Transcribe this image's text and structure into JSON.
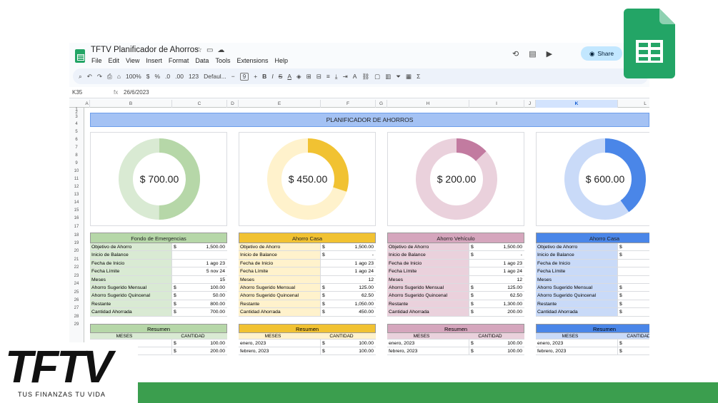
{
  "app": {
    "title": "TFTV Planificador de Ahorros",
    "menu": [
      "File",
      "Edit",
      "View",
      "Insert",
      "Format",
      "Data",
      "Tools",
      "Extensions",
      "Help"
    ],
    "share_label": "Share",
    "toolbar": {
      "zoom": "100%",
      "currency": "$",
      "percent": "%",
      "dec_less": ".0",
      "dec_more": ".00",
      "num_format": "123",
      "font": "Defaul...",
      "font_size": "9"
    },
    "formula_bar": {
      "cell_ref": "K35",
      "fx": "fx",
      "value": "26/6/2023"
    }
  },
  "sheet": {
    "columns": [
      "A",
      "B",
      "C",
      "D",
      "E",
      "F",
      "G",
      "H",
      "I",
      "J",
      "K",
      "L"
    ],
    "selected_column": "K",
    "rows": [
      "1",
      "2",
      "3",
      "4",
      "5",
      "6",
      "7",
      "8",
      "9",
      "10",
      "11",
      "12",
      "13",
      "14",
      "15",
      "16",
      "17",
      "18",
      "19",
      "20",
      "21",
      "22",
      "23",
      "24",
      "25",
      "26",
      "27",
      "28",
      "29"
    ],
    "banner": "PLANIFICADOR DE AHORROS",
    "cards": [
      {
        "value": "$ 700.00",
        "percent": 50,
        "fill": "#b6d7a8",
        "track": "#d9ead3",
        "header": "Fondo de Emergencias",
        "head_bg": "#b6d7a8",
        "label_bg": "#d9ead3",
        "rows": [
          [
            "Objetivo de Ahorro",
            "$",
            "1,500.00"
          ],
          [
            "Inicio de Balance",
            "",
            ""
          ],
          [
            "Fecha de Inicio",
            "",
            "1 ago 23"
          ],
          [
            "Fecha Límite",
            "",
            "5 nov 24"
          ],
          [
            "Meses",
            "",
            "15"
          ],
          [
            "Ahorro Sugerido Mensual",
            "$",
            "100.00"
          ],
          [
            "Ahorro Sugerido Quincenal",
            "$",
            "50.00"
          ],
          [
            "Restante",
            "$",
            "800.00"
          ],
          [
            "Cantidad Ahorrada",
            "$",
            "700.00"
          ]
        ],
        "resumen": [
          [
            "",
            "$",
            "100.00"
          ],
          [
            "",
            "$",
            "200.00"
          ]
        ]
      },
      {
        "value": "$ 450.00",
        "percent": 30,
        "fill": "#f1c232",
        "track": "#fff2cc",
        "header": "Ahorro Casa",
        "head_bg": "#f1c232",
        "label_bg": "#fff2cc",
        "rows": [
          [
            "Objetivo de Ahorro",
            "$",
            "1,500.00"
          ],
          [
            "Inicio de Balance",
            "$",
            "-"
          ],
          [
            "Fecha de Inicio",
            "",
            "1 ago 23"
          ],
          [
            "Fecha Límite",
            "",
            "1 ago 24"
          ],
          [
            "Meses",
            "",
            "12"
          ],
          [
            "Ahorro Sugerido Mensual",
            "$",
            "125.00"
          ],
          [
            "Ahorro Sugerido Quincenal",
            "$",
            "62.50"
          ],
          [
            "Restante",
            "$",
            "1,050.00"
          ],
          [
            "Cantidad Ahorrada",
            "$",
            "450.00"
          ]
        ],
        "resumen": [
          [
            "enero, 2023",
            "$",
            "100.00"
          ],
          [
            "febrero, 2023",
            "$",
            "100.00"
          ]
        ]
      },
      {
        "value": "$ 200.00",
        "percent": 13,
        "fill": "#c27ba0",
        "track": "#ead1dc",
        "header": "Ahorro Vehículo",
        "head_bg": "#d5a6bd",
        "label_bg": "#ead1dc",
        "rows": [
          [
            "Objetivo de Ahorro",
            "$",
            "1,500.00"
          ],
          [
            "Inicio de Balance",
            "$",
            "-"
          ],
          [
            "Fecha de Inicio",
            "",
            "1 ago 23"
          ],
          [
            "Fecha Límite",
            "",
            "1 ago 24"
          ],
          [
            "Meses",
            "",
            "12"
          ],
          [
            "Ahorro Sugerido Mensual",
            "$",
            "125.00"
          ],
          [
            "Ahorro Sugerido Quincenal",
            "$",
            "62.50"
          ],
          [
            "Restante",
            "$",
            "1,300.00"
          ],
          [
            "Cantidad Ahorrada",
            "$",
            "200.00"
          ]
        ],
        "resumen": [
          [
            "enero, 2023",
            "$",
            "100.00"
          ],
          [
            "febrero, 2023",
            "$",
            "100.00"
          ]
        ]
      },
      {
        "value": "$ 600.00",
        "percent": 40,
        "fill": "#4a86e8",
        "track": "#c9daf8",
        "header": "Ahorro Casa",
        "head_bg": "#4a86e8",
        "label_bg": "#c9daf8",
        "rows": [
          [
            "Objetivo de Ahorro",
            "$",
            ""
          ],
          [
            "Inicio de Balance",
            "$",
            ""
          ],
          [
            "Fecha de Inicio",
            "",
            ""
          ],
          [
            "Fecha Límite",
            "",
            ""
          ],
          [
            "Meses",
            "",
            ""
          ],
          [
            "Ahorro Sugerido Mensual",
            "$",
            ""
          ],
          [
            "Ahorro Sugerido Quincenal",
            "$",
            ""
          ],
          [
            "Restante",
            "$",
            ""
          ],
          [
            "Cantidad Ahorrada",
            "$",
            ""
          ]
        ],
        "resumen": [
          [
            "enero, 2023",
            "$",
            ""
          ],
          [
            "febrero, 2023",
            "$",
            ""
          ]
        ]
      }
    ],
    "resumen_title": "Resumen",
    "resumen_cols": [
      "MESES",
      "CANTIDAD"
    ]
  },
  "brand": {
    "logo_text": "TFTV",
    "tagline": "TUS FINANZAS TU VIDA",
    "green": "#3b9e4e"
  }
}
